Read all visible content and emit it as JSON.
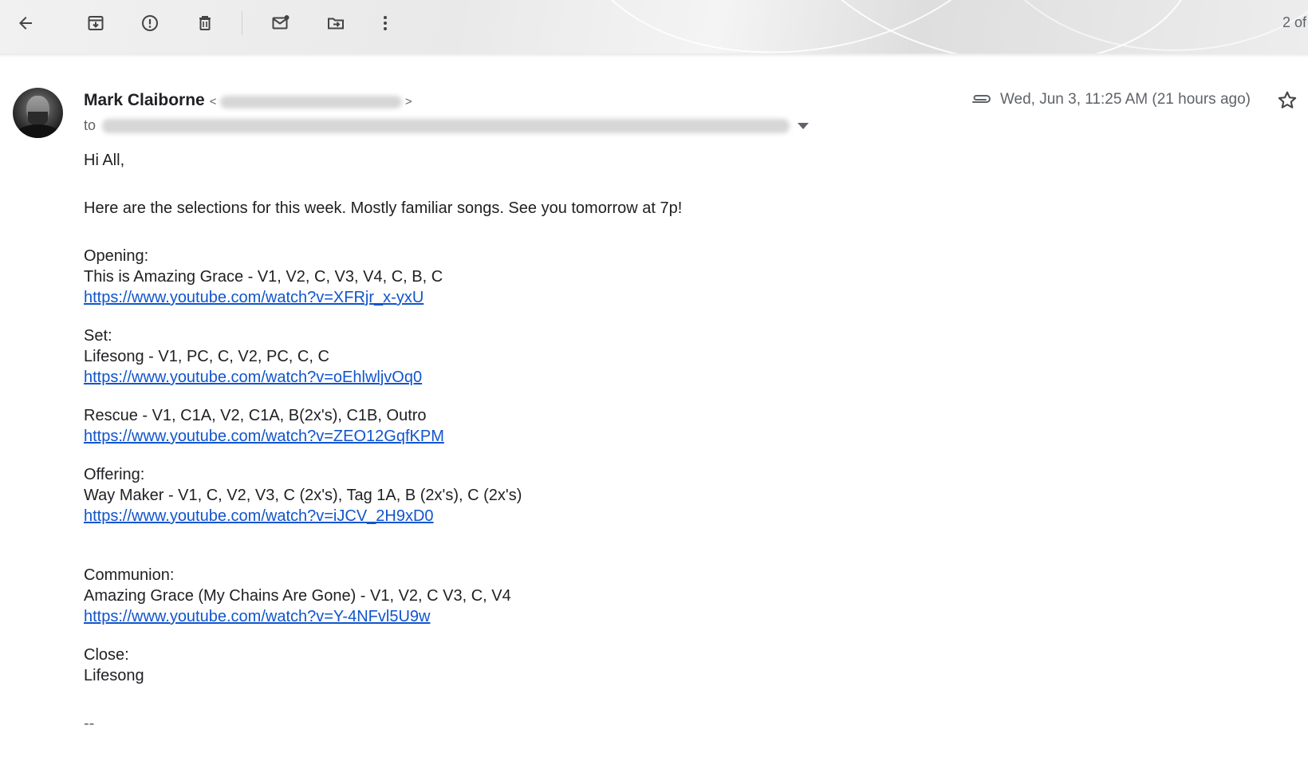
{
  "toolbar": {
    "buttons": [
      {
        "id": "back",
        "icon": "arrow-left-icon",
        "tooltip": "Back to Inbox"
      },
      {
        "id": "archive",
        "icon": "archive-icon",
        "tooltip": "Archive"
      },
      {
        "id": "spam",
        "icon": "report-spam-icon",
        "tooltip": "Report spam"
      },
      {
        "id": "delete",
        "icon": "trash-icon",
        "tooltip": "Delete"
      },
      {
        "id": "unread",
        "icon": "mark-unread-icon",
        "tooltip": "Mark as unread"
      },
      {
        "id": "move",
        "icon": "move-to-icon",
        "tooltip": "Move to"
      },
      {
        "id": "more",
        "icon": "more-vertical-icon",
        "tooltip": "More"
      }
    ],
    "pager_text": "2 of"
  },
  "message": {
    "sender_name": "Mark Claiborne",
    "sender_email_open": "<",
    "sender_email_close": ">",
    "to_label": "to",
    "date": "Wed, Jun 3, 11:25 AM (21 hours ago)",
    "has_attachment": true
  },
  "body": {
    "greeting": "Hi All,",
    "intro": "Here are the selections for this week. Mostly familiar songs. See you tomorrow at 7p!",
    "opening_label": "Opening:",
    "opening_song": "This is Amazing Grace - V1, V2, C, V3, V4, C, B, C",
    "opening_link": "https://www.youtube.com/watch?v=XFRjr_x-yxU",
    "set_label": "Set:",
    "set_song1": "Lifesong - V1, PC, C, V2, PC, C, C",
    "set_link1": "https://www.youtube.com/watch?v=oEhlwljvOq0",
    "set_song2": "Rescue - V1, C1A, V2, C1A, B(2x's), C1B, Outro",
    "set_link2": "https://www.youtube.com/watch?v=ZEO12GqfKPM",
    "offering_label": "Offering:",
    "offering_song": "Way Maker - V1, C, V2, V3, C (2x's), Tag 1A, B (2x's), C (2x's)",
    "offering_link": "https://www.youtube.com/watch?v=iJCV_2H9xD0",
    "communion_label": "Communion:",
    "communion_song": "Amazing Grace (My Chains Are Gone) - V1, V2, C V3, C, V4",
    "communion_link": "https://www.youtube.com/watch?v=Y-4NFvl5U9w",
    "close_label": "Close:",
    "close_song": "Lifesong",
    "signature_sep": "--"
  }
}
